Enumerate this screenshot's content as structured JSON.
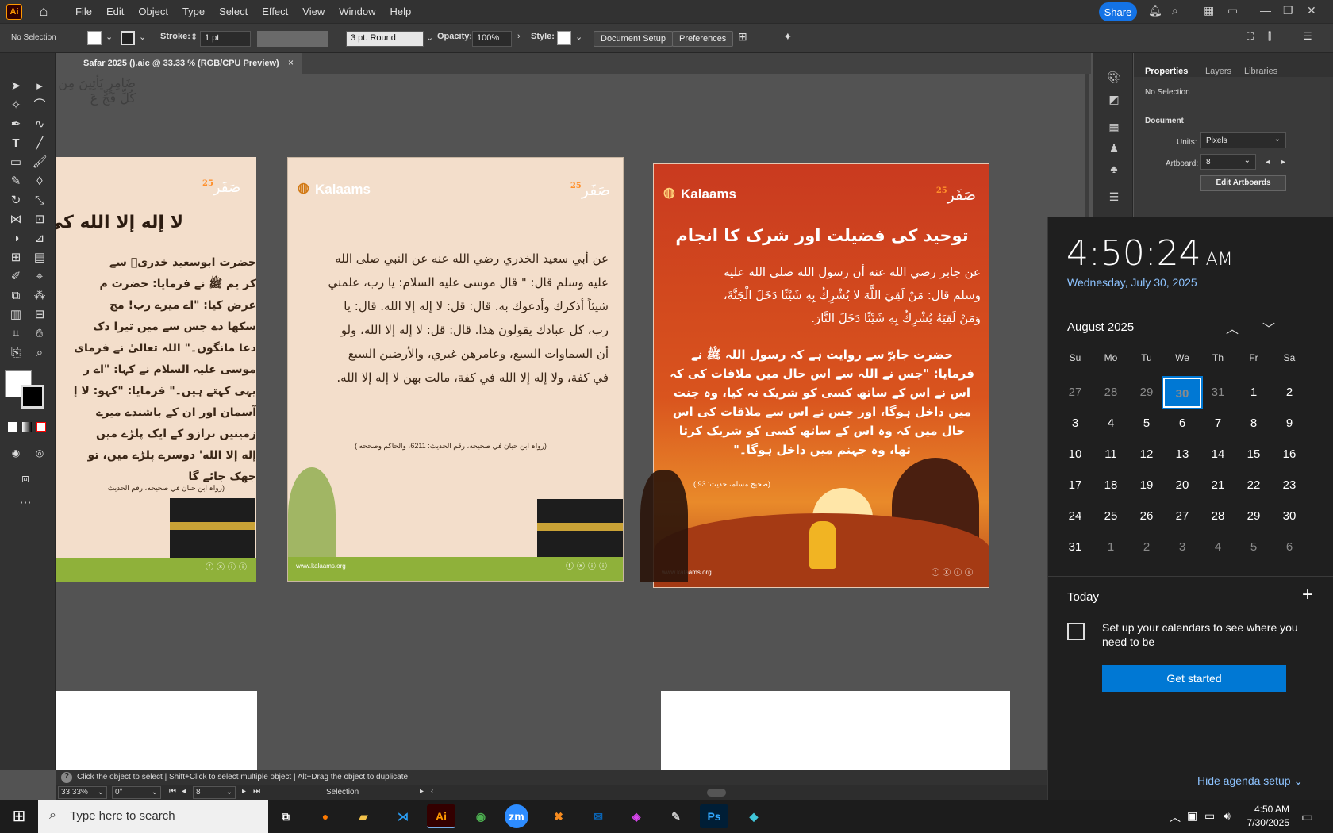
{
  "menubar": {
    "app_badge": "Ai",
    "items": [
      "File",
      "Edit",
      "Object",
      "Type",
      "Select",
      "Effect",
      "View",
      "Window",
      "Help"
    ],
    "share_label": "Share"
  },
  "control": {
    "selection": "No Selection",
    "stroke_label": "Stroke:",
    "stroke_value": "1 pt",
    "brush_value": "3 pt. Round",
    "opacity_label": "Opacity:",
    "opacity_value": "100%",
    "style_label": "Style:",
    "document_setup": "Document Setup",
    "preferences": "Preferences"
  },
  "document_tab": {
    "title": "Safar 2025 ().aic @ 33.33 % (RGB/CPU Preview)",
    "close": "×"
  },
  "artboards": {
    "left": {
      "title": "لا إله إلا الله کی",
      "lines": [
        "حضرت ابوسعید خدریؓ سے",
        "کر یم ﷺ نے فرمایا: حضرت م",
        "عرض کیا: \"اے میرے رب! مج",
        "سکھا دے جس سے میں تیرا ذک",
        "دعا مانگوں۔\" اللہ تعالیٰ نے فرمای",
        "موسی علیہ السلام نے کہا: \"اے ر",
        "یہی کہتے ہیں۔\" فرمایا: \"کہو: لا إ",
        "آسمان اور ان کے باشندے میرے",
        "زمینیں ترازو کے ایک پلڑے میں",
        "إله إلا الله' دوسرے پلڑے میں، تو",
        "جھک جائے گا"
      ],
      "reference": "(رواہ ابن حبان في صحیحه، رقم الحديث"
    },
    "middle": {
      "logo": "Kalaams",
      "safar_text": "صَفَر",
      "safar_num": "25",
      "lines": [
        "عن أبي سعيد الخدري رضي الله عنه عن النبي صلى الله",
        "عليه وسلم قال: \" قال موسى عليه السلام: يا رب، علمني",
        "شيئاً أذكرك وأدعوك به. قال: قل: لا إله إلا الله. قال: يا",
        "رب، كل عبادك يقولون هذا. قال: قل: لا إله إلا الله، ولو",
        "أن السماوات السبع، وعامرهن غيري، والأرضين السبع",
        "في كفة، ولا إله إلا الله في كفة، مالت بهن لا إله إلا الله."
      ],
      "reference": "(رواہ ابن حبان في صحیحه، رقم الحديث: 6211، والحاكم وصححه )",
      "website": "www.kalaams.org"
    },
    "right": {
      "logo": "Kalaams",
      "safar_text": "صَفَر",
      "safar_num": "25",
      "title": "توحید کی فضیلت اور شرک کا انجام",
      "arabic_lines": [
        "عن جابر رضي الله عنه أن رسول الله صلى الله عليه",
        "وسلم قال: مَنْ لَقِيَ اللَّهَ لا يُشْرِكُ بِهِ شَيْئًا دَخَلَ الْجَنَّةَ،",
        "وَمَنْ لَقِيَهُ يُشْرِكُ بِهِ شَيْئًا دَخَلَ النَّارَ."
      ],
      "urdu_lines": [
        "حضرت جابرؓ سے روایت ہے کہ رسول اللہ ﷺ نے",
        "فرمایا: \"جس نے اللہ سے اس حال میں ملاقات کی کہ",
        "اس نے اس کے ساتھ کسی کو شریک نہ کیا، وہ جنت",
        "میں داخل ہوگا، اور جس نے اس سے ملاقات کی اس",
        "حال میں کہ وہ اس کے ساتھ کسی کو شریک کرتا",
        "تھا، وہ جہنم میں داخل ہوگا۔\""
      ],
      "reference": "(صحیح مسلم، حدیث: 93 )",
      "website": "www.kalaams.org"
    },
    "top_fragment": "ضَامِرٍ يَأْتِينَ مِن كُلِّ فَجٍّ عَ"
  },
  "properties_panel": {
    "tabs": [
      "Properties",
      "Layers",
      "Libraries"
    ],
    "selection": "No Selection",
    "section": "Document",
    "units_label": "Units:",
    "units_value": "Pixels",
    "artboard_label": "Artboard:",
    "artboard_value": "8",
    "edit_artboards": "Edit Artboards"
  },
  "status": {
    "hint": "Click the object to select  |  Shift+Click to select multiple object  |  Alt+Drag the object to duplicate",
    "zoom": "33.33%",
    "rotation": "0°",
    "artboard_num": "8",
    "mode": "Selection"
  },
  "clock_flyout": {
    "time": "4:50:24",
    "ampm": "AM",
    "date": "Wednesday, July 30, 2025",
    "month": "August 2025",
    "dow": [
      "Su",
      "Mo",
      "Tu",
      "We",
      "Th",
      "Fr",
      "Sa"
    ],
    "weeks": [
      [
        "27",
        "28",
        "29",
        "30",
        "31",
        "1",
        "2"
      ],
      [
        "3",
        "4",
        "5",
        "6",
        "7",
        "8",
        "9"
      ],
      [
        "10",
        "11",
        "12",
        "13",
        "14",
        "15",
        "16"
      ],
      [
        "17",
        "18",
        "19",
        "20",
        "21",
        "22",
        "23"
      ],
      [
        "24",
        "25",
        "26",
        "27",
        "28",
        "29",
        "30"
      ],
      [
        "31",
        "1",
        "2",
        "3",
        "4",
        "5",
        "6"
      ]
    ],
    "today_label": "Today",
    "setup_text": "Set up your calendars to see where you need to be",
    "get_started": "Get started",
    "hide_agenda": "Hide agenda setup"
  },
  "taskbar": {
    "search_placeholder": "Type here to search",
    "time": "4:50 AM",
    "date": "7/30/2025",
    "apps": [
      "Ai",
      "zm",
      "Ps"
    ]
  },
  "colors": {
    "accent": "#0078d4",
    "share": "#1473e6",
    "artboard_cream": "#f3decb",
    "artboard_orange": "#d9541e"
  }
}
